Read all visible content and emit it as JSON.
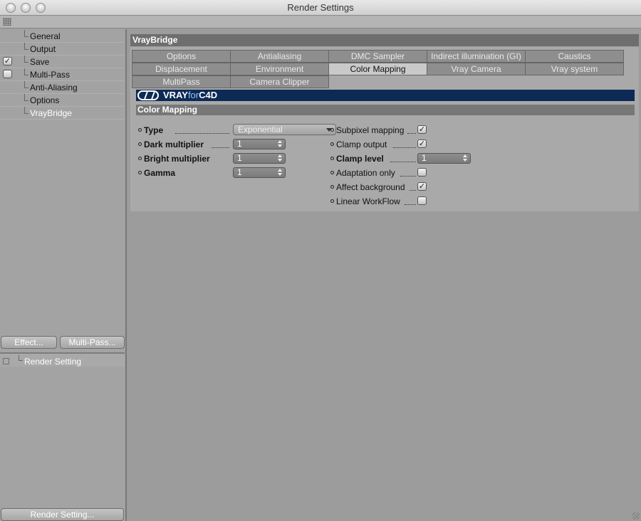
{
  "window": {
    "title": "Render Settings"
  },
  "sidebar": {
    "items": [
      {
        "label": "General",
        "checkbox": null
      },
      {
        "label": "Output",
        "checkbox": null
      },
      {
        "label": "Save",
        "checkbox": "checked"
      },
      {
        "label": "Multi-Pass",
        "checkbox": "unchecked"
      },
      {
        "label": "Anti-Aliasing",
        "checkbox": null
      },
      {
        "label": "Options",
        "checkbox": null
      },
      {
        "label": "VrayBridge",
        "checkbox": null,
        "active": true
      }
    ],
    "effect_button": "Effect...",
    "multipass_button": "Multi-Pass...",
    "render_setting_item": "Render Setting",
    "render_setting_button": "Render Setting..."
  },
  "panel": {
    "title": "VrayBridge",
    "tabs_row1": [
      "Options",
      "Antialiasing",
      "DMC Sampler",
      "Indirect illumination (GI)",
      "Caustics"
    ],
    "tabs_row2": [
      "Displacement",
      "Environment",
      "Color Mapping",
      "Vray Camera",
      "Vray system"
    ],
    "tabs_row3": [
      "MultiPass",
      "Camera Clipper"
    ],
    "selected_tab": "Color Mapping",
    "banner": {
      "brand": "VRAY",
      "for": "for",
      "product": "C4D"
    },
    "section_title": "Color Mapping",
    "left_fields": [
      {
        "label": "Type",
        "value": "Exponential",
        "kind": "combo"
      },
      {
        "label": "Dark multiplier",
        "value": "1",
        "kind": "spin"
      },
      {
        "label": "Bright multiplier",
        "value": "1",
        "kind": "spin"
      },
      {
        "label": "Gamma",
        "value": "1",
        "kind": "spin"
      }
    ],
    "right_fields": [
      {
        "label": "Subpixel mapping",
        "kind": "checkbox",
        "checked": true
      },
      {
        "label": "Clamp output",
        "kind": "checkbox",
        "checked": true
      },
      {
        "label": "Clamp level",
        "kind": "spin",
        "value": "1"
      },
      {
        "label": "Adaptation only",
        "kind": "checkbox",
        "checked": false
      },
      {
        "label": "Affect background",
        "kind": "checkbox",
        "checked": true
      },
      {
        "label": "Linear WorkFlow",
        "kind": "checkbox",
        "checked": false
      }
    ]
  },
  "icons": {
    "check_glyph": "✓"
  }
}
